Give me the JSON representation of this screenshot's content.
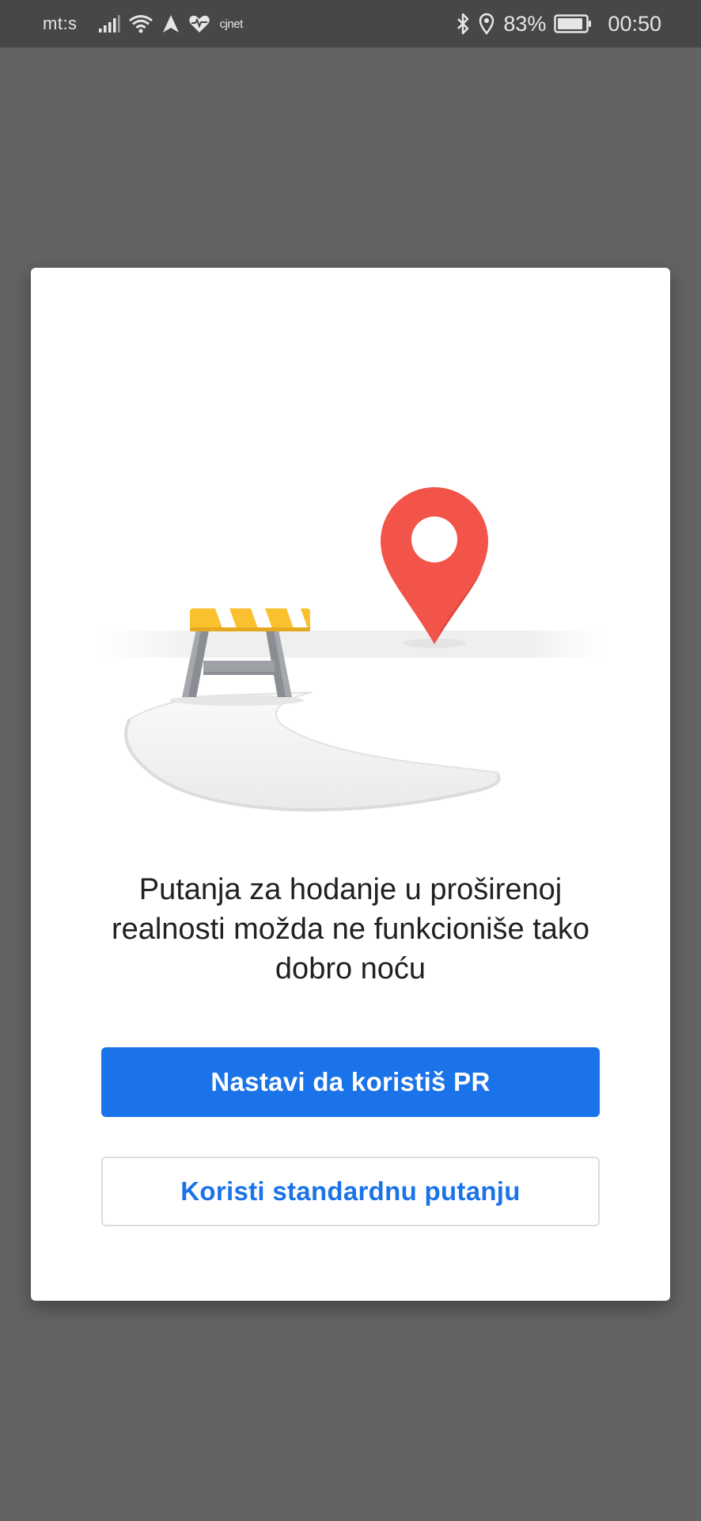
{
  "status_bar": {
    "carrier": "mt:s",
    "small_label": "cjnet",
    "battery_percent": "83%",
    "time": "00:50",
    "icons": [
      "signal-icon",
      "wifi-icon",
      "navigation-arrow-icon",
      "heart-rate-icon",
      "bluetooth-icon",
      "location-pin-icon",
      "battery-icon"
    ]
  },
  "dialog": {
    "illustration": "roadblock-map-pin-illustration",
    "message": "Putanja za hodanje u proširenoj realnosti možda ne funkcioniše tako dobro noću",
    "primary_button": "Nastavi da koristiš PR",
    "secondary_button": "Koristi standardnu putanju"
  },
  "colors": {
    "overlay": "#636363",
    "status_bar": "#474747",
    "accent": "#1a73e8",
    "pin": "#f2544a",
    "barrier_stripe": "#fbc02d"
  }
}
